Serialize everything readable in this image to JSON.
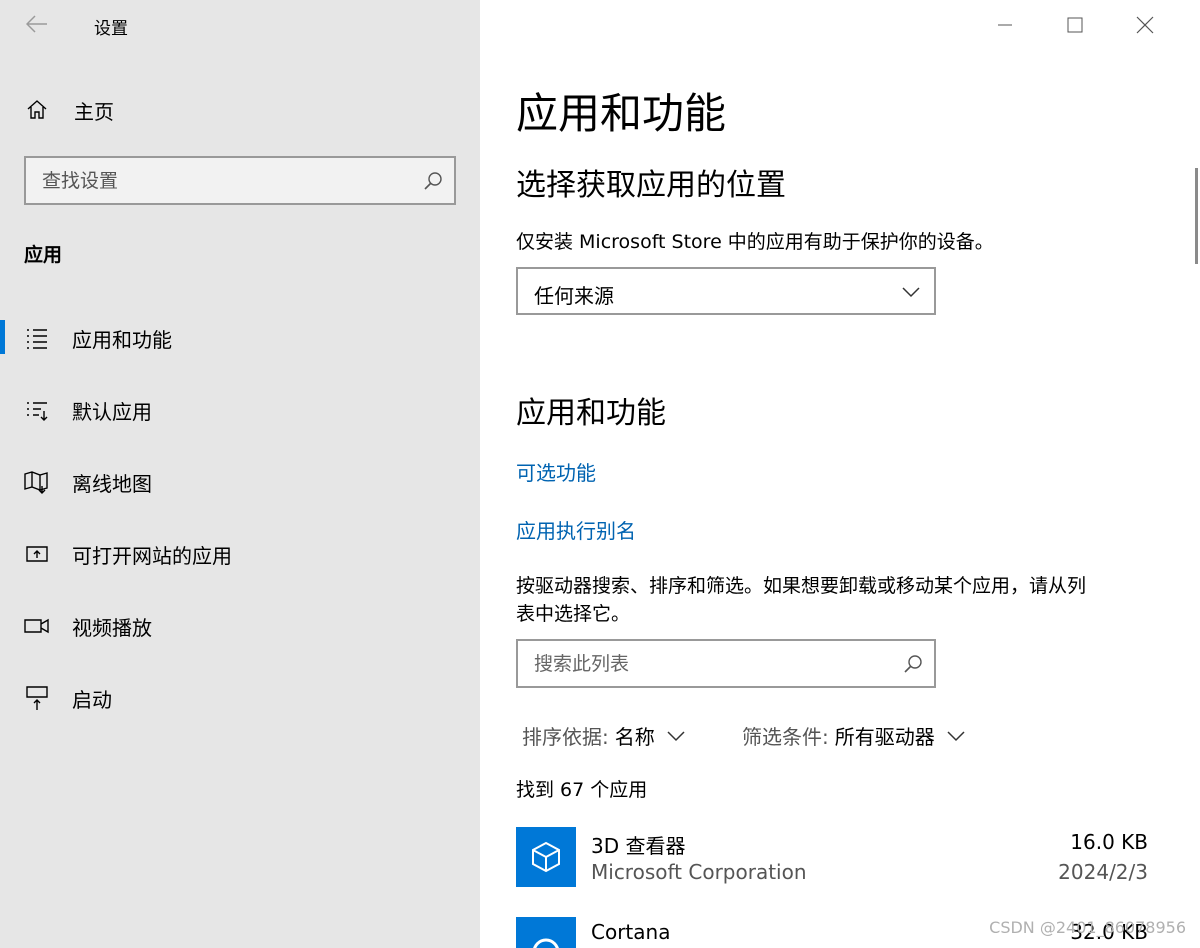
{
  "window": {
    "title": "设置"
  },
  "sidebar": {
    "home_label": "主页",
    "search_placeholder": "查找设置",
    "section": "应用",
    "items": [
      {
        "label": "应用和功能",
        "icon": "apps-list-icon"
      },
      {
        "label": "默认应用",
        "icon": "default-apps-icon"
      },
      {
        "label": "离线地图",
        "icon": "map-icon"
      },
      {
        "label": "可打开网站的应用",
        "icon": "open-web-icon"
      },
      {
        "label": "视频播放",
        "icon": "video-icon"
      },
      {
        "label": "启动",
        "icon": "startup-icon"
      }
    ]
  },
  "main": {
    "title": "应用和功能",
    "source_heading": "选择获取应用的位置",
    "source_desc": "仅安装 Microsoft Store 中的应用有助于保护你的设备。",
    "source_value": "任何来源",
    "apps_heading": "应用和功能",
    "link_optional": "可选功能",
    "link_alias": "应用执行别名",
    "list_desc_line1": "按驱动器搜索、排序和筛选。如果想要卸载或移动某个应用，请从列",
    "list_desc_line2": "表中选择它。",
    "list_search_placeholder": "搜索此列表",
    "sort_key": "排序依据:",
    "sort_value": "名称",
    "filter_key": "筛选条件:",
    "filter_value": "所有驱动器",
    "count_text": "找到 67 个应用",
    "apps": [
      {
        "name": "3D 查看器",
        "publisher": "Microsoft Corporation",
        "size": "16.0 KB",
        "date": "2024/2/3"
      },
      {
        "name": "Cortana",
        "publisher": "",
        "size": "32.0 KB",
        "date": ""
      }
    ]
  },
  "watermark": "CSDN @2401_86078956",
  "colors": {
    "accent": "#0078d7",
    "link": "#0063b1",
    "sidebar_bg": "#e6e6e6"
  }
}
